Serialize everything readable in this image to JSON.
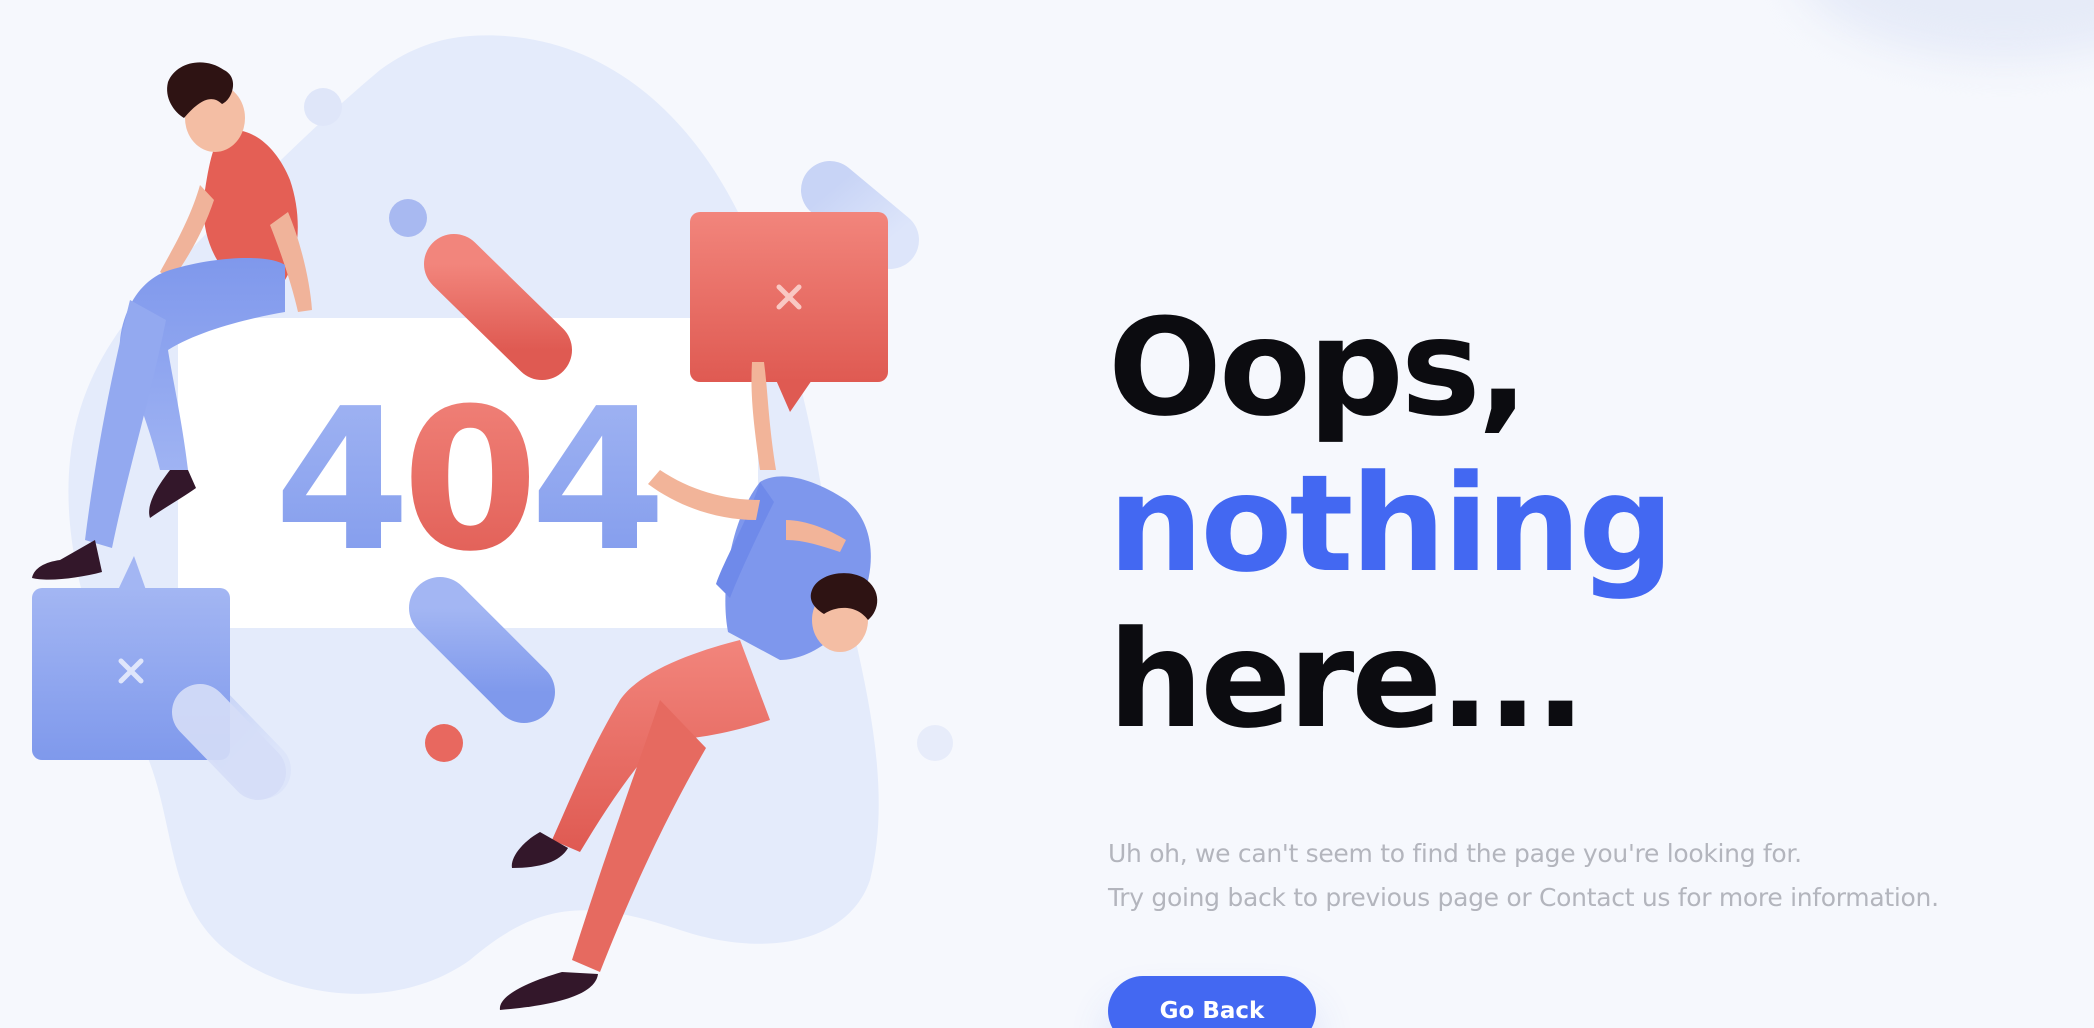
{
  "illustration": {
    "code": [
      "4",
      "0",
      "4"
    ],
    "colors": {
      "primary": "#4368f2",
      "blue_soft": "#8ea5ee",
      "red": "#e25a53",
      "blob": "#e4ebfb"
    },
    "icons": [
      "close-x-icon",
      "close-x-icon"
    ]
  },
  "headline": {
    "line1": "Oops,",
    "accent": "nothing",
    "rest": " here..."
  },
  "message": {
    "line1": "Uh oh, we can't seem to find the page you're looking for.",
    "line2": "Try going back to previous page or Contact us for more information."
  },
  "button": {
    "label": "Go Back"
  },
  "colors": {
    "accent": "#4368f2",
    "text": "#0c0c10",
    "muted": "#b3b5bd",
    "background": "#f6f8fd"
  }
}
